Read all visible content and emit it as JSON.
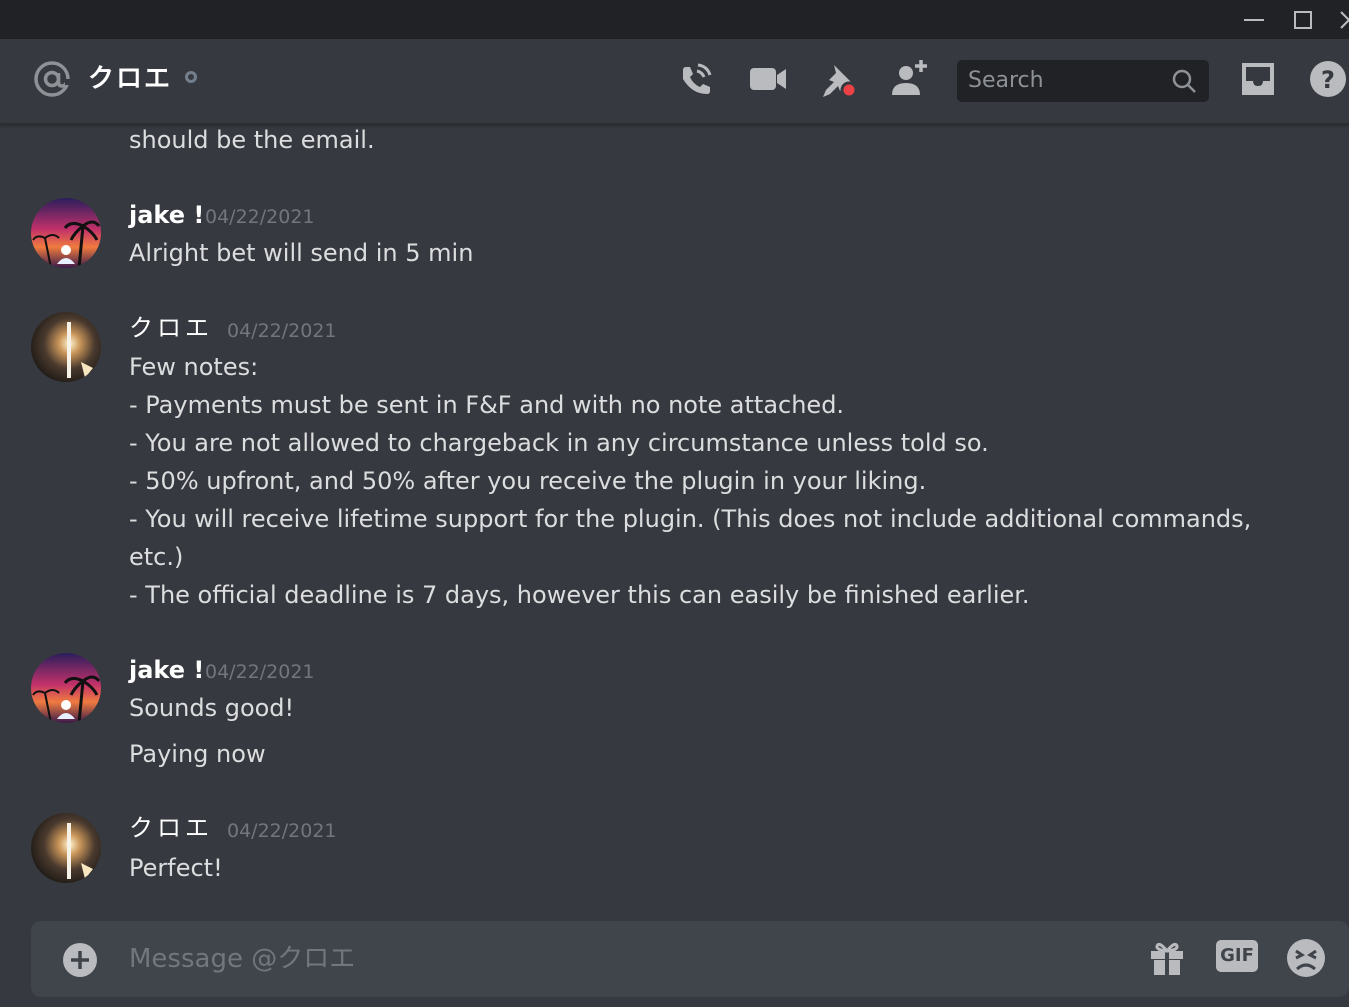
{
  "header": {
    "channel_name": "クロエ",
    "search_placeholder": "Search"
  },
  "messages": {
    "prev_tail": "should be the email.",
    "groups": [
      {
        "author": "jake !",
        "timestamp": "04/22/2021",
        "lines": [
          "Alright bet will send in 5 min"
        ]
      },
      {
        "author": "クロエ",
        "timestamp": "04/22/2021",
        "lines": [
          "Few notes:",
          "- Payments must be sent in F&F and with no note attached.",
          "- You are not allowed to chargeback in any circumstance unless told so.",
          "- 50% upfront, and 50% after you receive the plugin in your liking.",
          "- You will receive lifetime support for the plugin. (This does not include additional commands,",
          "etc.)",
          "- The official deadline is 7 days, however this can easily be finished earlier."
        ]
      },
      {
        "author": "jake !",
        "timestamp": "04/22/2021",
        "lines": [
          "Sounds good!",
          "Paying now"
        ]
      },
      {
        "author": "クロエ",
        "timestamp": "04/22/2021",
        "lines": [
          "Perfect!"
        ]
      }
    ]
  },
  "composer": {
    "placeholder": "Message @クロエ",
    "gif_label": "GIF"
  },
  "colors": {
    "background": "#36393f",
    "titlebar": "#202225",
    "composer": "#40444b",
    "notification_red": "#ed4245",
    "status_idle": "#747f8d"
  },
  "icons": [
    "at-icon",
    "call-icon",
    "video-icon",
    "pin-icon",
    "add-friend-icon",
    "search-icon",
    "inbox-icon",
    "help-icon",
    "plus-icon",
    "gift-icon",
    "emoji-icon"
  ]
}
